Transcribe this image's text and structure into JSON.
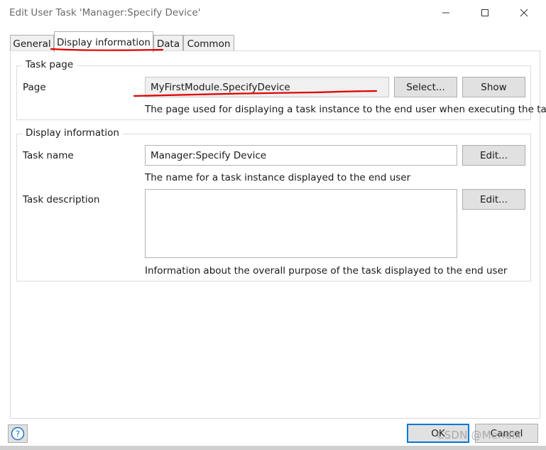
{
  "window": {
    "title": "Edit User Task 'Manager:Specify Device'"
  },
  "tabs": [
    {
      "label": "General",
      "active": false
    },
    {
      "label": "Display information",
      "active": true
    },
    {
      "label": "Data",
      "active": false
    },
    {
      "label": "Common",
      "active": false
    }
  ],
  "task_page": {
    "legend": "Task page",
    "page_label": "Page",
    "page_value": "MyFirstModule.SpecifyDevice",
    "select_label": "Select...",
    "show_label": "Show",
    "hint": "The page used for displaying a task instance to the end user when executing the task"
  },
  "display_information": {
    "legend": "Display information",
    "task_name_label": "Task name",
    "task_name_value": "Manager:Specify Device",
    "task_name_edit": "Edit...",
    "task_name_hint": "The name for a task instance displayed to the end user",
    "task_description_label": "Task description",
    "task_description_value": "",
    "task_description_edit": "Edit...",
    "task_description_hint": "Information about the overall purpose of the task displayed to the end user"
  },
  "footer": {
    "ok_label": "OK",
    "cancel_label": "Cancel",
    "help_glyph": "?"
  },
  "watermark": "CSDN @Mendix",
  "icons": {
    "minimize": "minimize-icon",
    "maximize": "maximize-icon",
    "close": "close-icon",
    "help": "help-icon"
  },
  "colors": {
    "accent": "#0078d7",
    "annotation": "#e00000"
  }
}
